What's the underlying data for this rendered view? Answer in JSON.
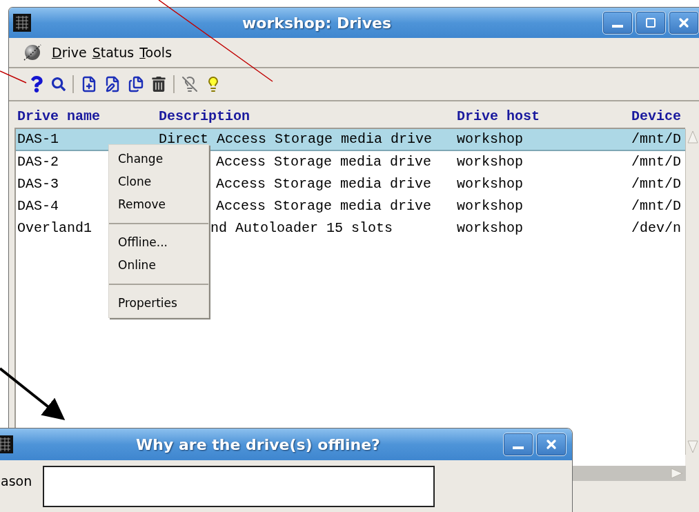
{
  "window": {
    "title": "workshop: Drives"
  },
  "menus": [
    {
      "label": "Drive"
    },
    {
      "label": "Status"
    },
    {
      "label": "Tools"
    }
  ],
  "table": {
    "columns": [
      "Drive name",
      "Description",
      "Drive host",
      "Device"
    ],
    "rows": [
      {
        "cells": [
          "DAS-1",
          "Direct Access Storage media drive",
          "workshop",
          "/mnt/D"
        ],
        "selected": true
      },
      {
        "cells": [
          "DAS-2",
          "Access Storage media drive",
          "workshop",
          "/mnt/D"
        ],
        "selected": false
      },
      {
        "cells": [
          "DAS-3",
          "Access Storage media drive",
          "workshop",
          "/mnt/D"
        ],
        "selected": false
      },
      {
        "cells": [
          "DAS-4",
          "Access Storage media drive",
          "workshop",
          "/mnt/D"
        ],
        "selected": false
      },
      {
        "cells": [
          "Overland1",
          "nd Autoloader 15 slots",
          "workshop",
          "/dev/n"
        ],
        "selected": false
      }
    ]
  },
  "context_menu": {
    "items": [
      {
        "kind": "item",
        "label": "Change"
      },
      {
        "kind": "item",
        "label": "Clone"
      },
      {
        "kind": "item",
        "label": "Remove"
      },
      {
        "kind": "separator"
      },
      {
        "kind": "item",
        "label": "Offline..."
      },
      {
        "kind": "item",
        "label": "Online"
      },
      {
        "kind": "separator"
      },
      {
        "kind": "item",
        "label": "Properties"
      }
    ]
  },
  "dialog": {
    "title": "Why are the drive(s) offline?",
    "field_label": "ason"
  }
}
